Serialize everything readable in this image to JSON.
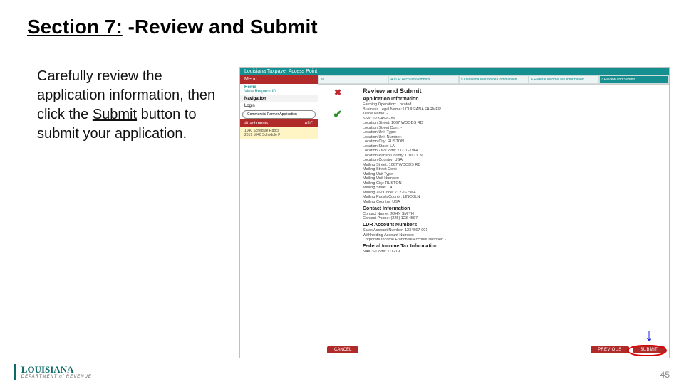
{
  "title": {
    "section": "Section 7:",
    "rest": " -Review and Submit"
  },
  "instructions": {
    "p1": "Carefully review the application information, then click the ",
    "submit": "Submit",
    "p2": " button to submit your application."
  },
  "app": {
    "header": "Louisiana Taxpayer Access Point",
    "side": {
      "menu": "Menu",
      "home": "Home",
      "request": "View Request ID",
      "nav": "Navigation",
      "login": "Login",
      "appline": "Commercial Farmer Application",
      "attach": "Attachments",
      "add": "ADD",
      "file1": "1040 Schedule F.docx",
      "file2": "2019 1040 Schedule F"
    },
    "steps": [
      "fill",
      "4 LDR Account Numbers",
      "5 Louisiana Workforce Commission",
      "6 Federal Income Tax Information",
      "7 Review and Submit"
    ],
    "review": {
      "title": "Review and Submit",
      "sections": {
        "appinfo": "Application Information",
        "appinfo_rows": [
          "Farming Operation: Located",
          "Business Legal Name: LOUISIANA FARMER",
          "Trade Name: -",
          "SSN: 123-45-6789",
          "",
          "Location Street: 1067 WOODS RD",
          "Location Street Cont: -",
          "Location Unit Type: -",
          "Location Unit Number: -",
          "Location City: RUSTON",
          "Location State: LA",
          "Location ZIP Code: 71270-7964",
          "Location Parish/County: LINCOLN",
          "Location Country: USA",
          "",
          "Mailing Street: 1067 WOODS RD",
          "Mailing Street Cont: -",
          "Mailing Unit Type: -",
          "Mailing Unit Number: -",
          "Mailing City: RUSTON",
          "Mailing State: LA",
          "Mailing ZIP Code: 71270-7964",
          "Mailing Parish/County: LINCOLN",
          "Mailing Country: USA"
        ],
        "contact": "Contact Information",
        "contact_rows": [
          "Contact Name: JOHN SMITH",
          "Contact Phone: (225) 123-4567"
        ],
        "ldr": "LDR Account Numbers",
        "ldr_rows": [
          "Sales Account Number: 1234567-001",
          "Withholding Account Number: -",
          "Corporate Income Franchise Account Number: -"
        ],
        "fed": "Federal Income Tax Information",
        "fed_rows": [
          "NAICS Code: 111219"
        ]
      }
    },
    "buttons": {
      "cancel": "Cancel",
      "previous": "Previous",
      "submit": "Submit"
    }
  },
  "footer": {
    "logo1": "LOUISIANA",
    "logo2": "DEPARTMENT of REVENUE",
    "page": "45"
  }
}
